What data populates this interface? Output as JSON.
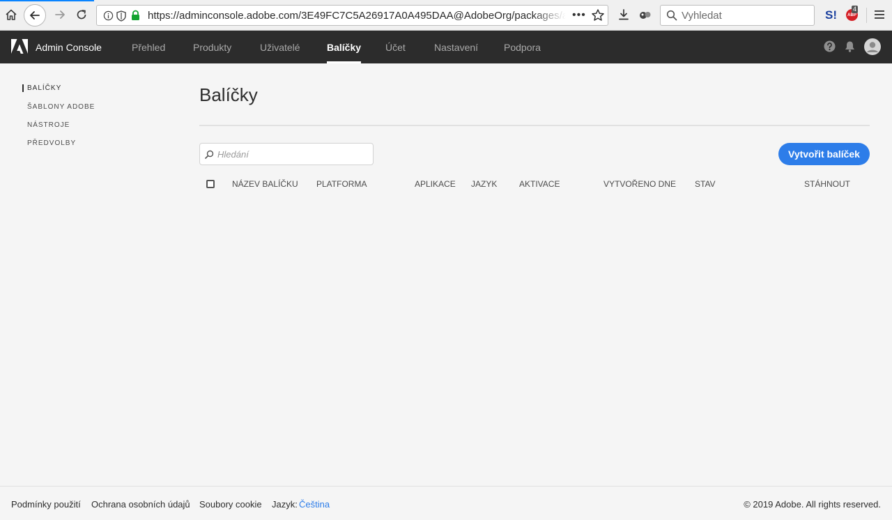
{
  "browser": {
    "url": "https://adminconsole.adobe.com/3E49FC7C5A26917A0A495DAA@AdobeOrg/packages/a",
    "search_placeholder": "Vyhledat",
    "page_actions_label": "•••",
    "abp_label": "ABP",
    "abp_count": "4",
    "ext_s_label": "S!"
  },
  "header": {
    "app_title": "Admin Console",
    "nav": [
      "Přehled",
      "Produkty",
      "Uživatelé",
      "Balíčky",
      "Účet",
      "Nastavení",
      "Podpora"
    ],
    "active_nav": "Balíčky"
  },
  "sidebar": {
    "items": [
      "BALÍČKY",
      "ŠABLONY ADOBE",
      "NÁSTROJE",
      "PŘEDVOLBY"
    ],
    "active_item": "BALÍČKY"
  },
  "main": {
    "title": "Balíčky",
    "search_placeholder": "Hledání",
    "create_button": "Vytvořit balíček",
    "columns": [
      "NÁZEV BALÍČKU",
      "PLATFORMA",
      "APLIKACE",
      "JAZYK",
      "AKTIVACE",
      "VYTVOŘENO DNE",
      "STAV",
      "STÁHNOUT"
    ],
    "rows": []
  },
  "footer": {
    "terms": "Podmínky použití",
    "privacy": "Ochrana osobních údajů",
    "cookies": "Soubory cookie",
    "language_label": "Jazyk:",
    "language_value": "Čeština",
    "copyright": "© 2019 Adobe. All rights reserved."
  },
  "colors": {
    "accent": "#2d7de9",
    "header_bg": "#2c2c2c",
    "page_bg": "#f5f5f5"
  }
}
